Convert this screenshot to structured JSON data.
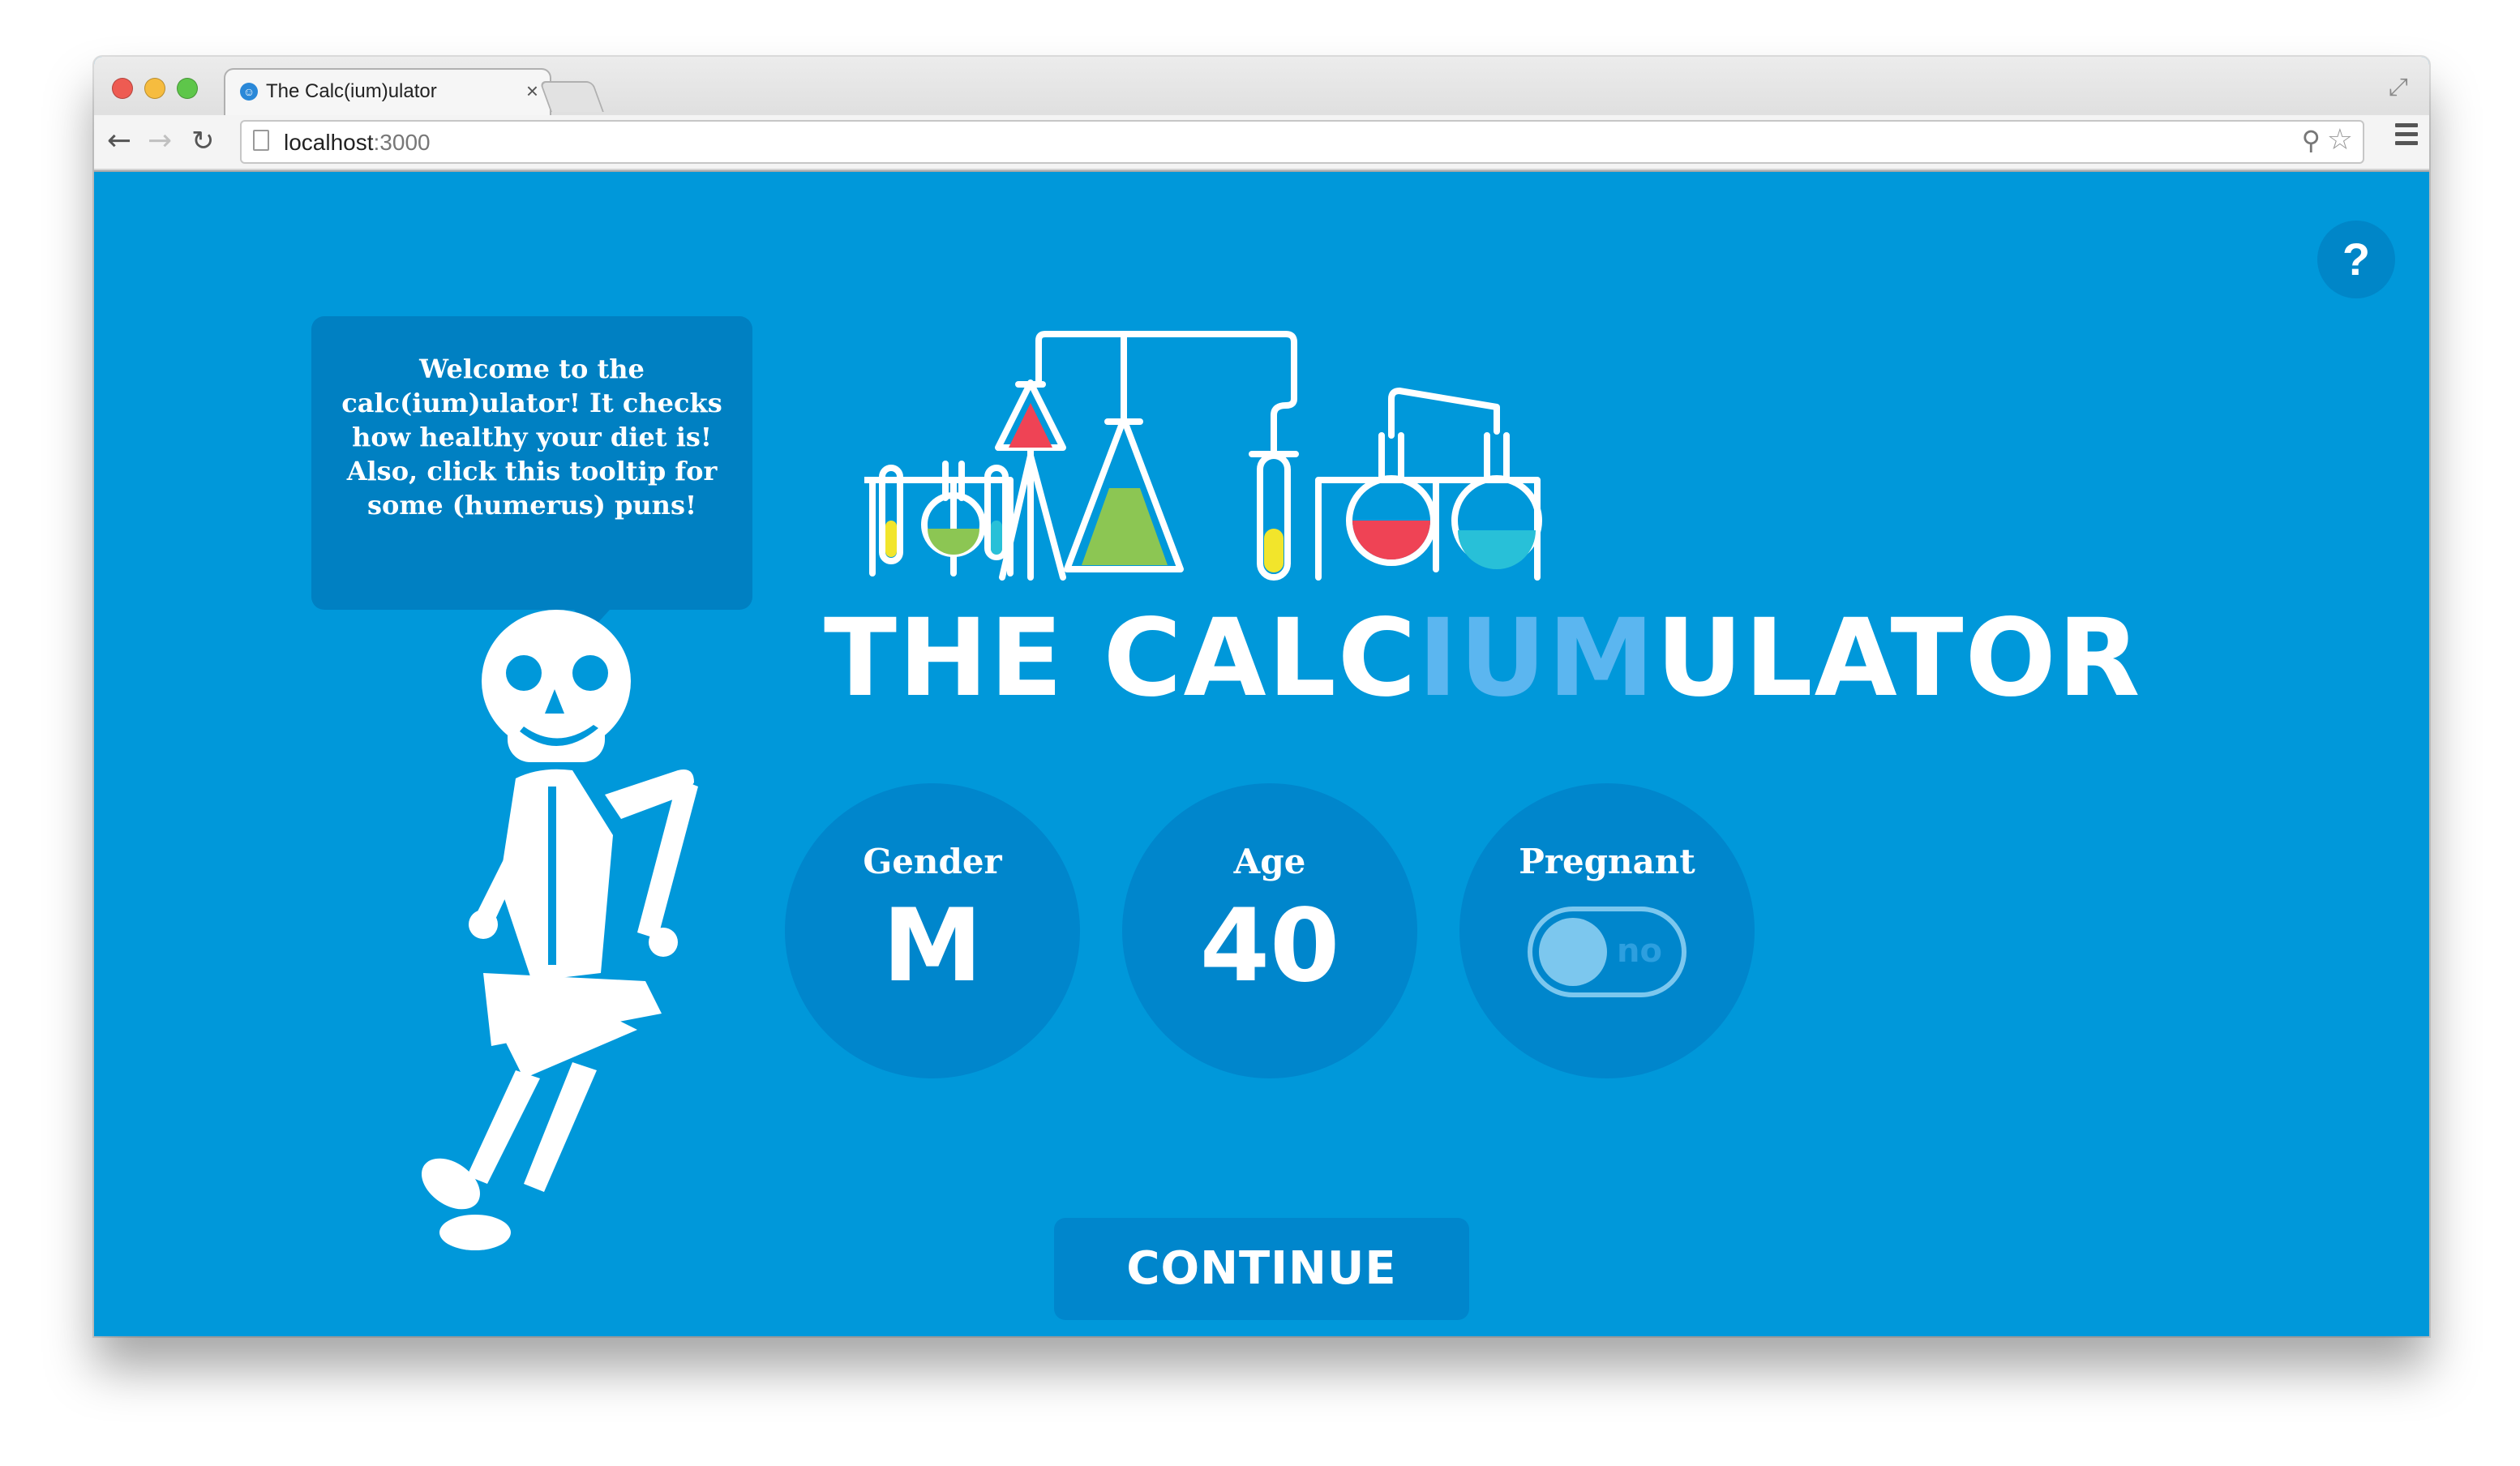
{
  "browser": {
    "tab_title": "The Calc(ium)ulator",
    "tab_close": "×",
    "url_host": "localhost",
    "url_port": ":3000"
  },
  "page": {
    "help_label": "?",
    "tooltip_text": "Welcome to the calc(ium)ulator! It checks how healthy your diet is! Also, click this tooltip for some (humerus) puns!",
    "title_start": "THE CALC",
    "title_mid": "IUM",
    "title_end": "ULATOR",
    "gender": {
      "label": "Gender",
      "value": "M"
    },
    "age": {
      "label": "Age",
      "value": "40"
    },
    "pregnant": {
      "label": "Pregnant",
      "toggle_text": "no",
      "checked": false
    },
    "continue_label": "CONTINUE"
  },
  "colors": {
    "background": "#0098da",
    "circle": "#0086cc",
    "title_accent": "#5bb6f0",
    "flask_red": "#ef4355",
    "flask_green": "#8cc653",
    "flask_yellow": "#f2e52b",
    "flask_cyan": "#28c0d8"
  },
  "icons": {
    "back": "back-arrow-icon",
    "forward": "forward-arrow-icon",
    "reload": "reload-icon",
    "zoom": "zoom-icon",
    "bookmark": "star-icon",
    "menu": "hamburger-menu-icon",
    "fullscreen": "fullscreen-icon"
  }
}
